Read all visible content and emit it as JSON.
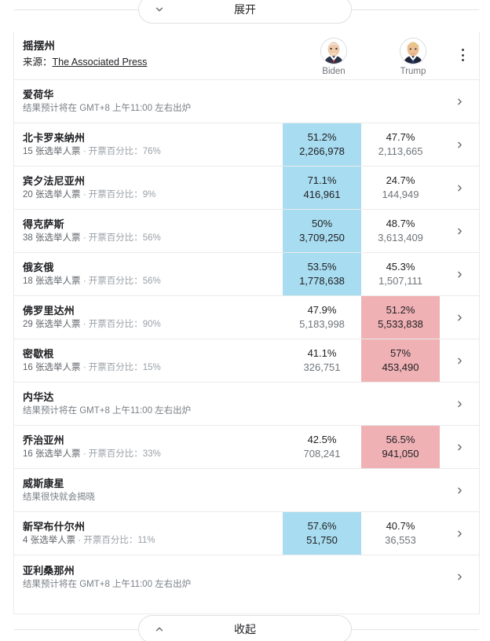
{
  "expand_button": {
    "label": "展开",
    "icon": "chevron-down-icon"
  },
  "collapse_button": {
    "label": "收起",
    "icon": "chevron-up-icon"
  },
  "header": {
    "title": "摇摆州",
    "source_prefix": "来源：",
    "source_name": "The Associated Press",
    "menu_icon": "overflow-menu-icon",
    "candidates": [
      {
        "name": "Biden",
        "avatar": "biden-avatar"
      },
      {
        "name": "Trump",
        "avatar": "trump-avatar"
      }
    ]
  },
  "colors": {
    "lead_blue": "#a8dcf0",
    "lead_red": "#f0b1b5",
    "text_primary": "#202124",
    "text_secondary": "#70757a",
    "border": "#eaeaea"
  },
  "chevron_icon": "chevron-right-icon",
  "rows": [
    {
      "state": "爱荷华",
      "note": "结果预计将在 GMT+8 上午11:00 左右出炉",
      "has_results": false
    },
    {
      "state": "北卡罗来纳州",
      "electoral": "15 张选举人票",
      "separator": " · ",
      "reporting": "开票百分比：76%",
      "has_results": true,
      "biden": {
        "pct": "51.2%",
        "votes": "2,266,978",
        "leading": true
      },
      "trump": {
        "pct": "47.7%",
        "votes": "2,113,665",
        "leading": false
      }
    },
    {
      "state": "宾夕法尼亚州",
      "electoral": "20 张选举人票",
      "separator": " · ",
      "reporting": "开票百分比：9%",
      "has_results": true,
      "biden": {
        "pct": "71.1%",
        "votes": "416,961",
        "leading": true
      },
      "trump": {
        "pct": "24.7%",
        "votes": "144,949",
        "leading": false
      }
    },
    {
      "state": "得克萨斯",
      "electoral": "38 张选举人票",
      "separator": " · ",
      "reporting": "开票百分比：56%",
      "has_results": true,
      "biden": {
        "pct": "50%",
        "votes": "3,709,250",
        "leading": true
      },
      "trump": {
        "pct": "48.7%",
        "votes": "3,613,409",
        "leading": false
      }
    },
    {
      "state": "俄亥俄",
      "electoral": "18 张选举人票",
      "separator": " · ",
      "reporting": "开票百分比：56%",
      "has_results": true,
      "biden": {
        "pct": "53.5%",
        "votes": "1,778,638",
        "leading": true
      },
      "trump": {
        "pct": "45.3%",
        "votes": "1,507,111",
        "leading": false
      }
    },
    {
      "state": "佛罗里达州",
      "electoral": "29 张选举人票",
      "separator": " · ",
      "reporting": "开票百分比：90%",
      "has_results": true,
      "biden": {
        "pct": "47.9%",
        "votes": "5,183,998",
        "leading": false
      },
      "trump": {
        "pct": "51.2%",
        "votes": "5,533,838",
        "leading": true
      }
    },
    {
      "state": "密歇根",
      "electoral": "16 张选举人票",
      "separator": " · ",
      "reporting": "开票百分比：15%",
      "has_results": true,
      "biden": {
        "pct": "41.1%",
        "votes": "326,751",
        "leading": false
      },
      "trump": {
        "pct": "57%",
        "votes": "453,490",
        "leading": true
      }
    },
    {
      "state": "内华达",
      "note": "结果预计将在 GMT+8 上午11:00 左右出炉",
      "has_results": false
    },
    {
      "state": "乔治亚州",
      "electoral": "16 张选举人票",
      "separator": " · ",
      "reporting": "开票百分比：33%",
      "has_results": true,
      "biden": {
        "pct": "42.5%",
        "votes": "708,241",
        "leading": false
      },
      "trump": {
        "pct": "56.5%",
        "votes": "941,050",
        "leading": true
      }
    },
    {
      "state": "威斯康星",
      "note": "结果很快就会揭晓",
      "has_results": false
    },
    {
      "state": "新罕布什尔州",
      "electoral": "4 张选举人票",
      "separator": " · ",
      "reporting": "开票百分比：11%",
      "has_results": true,
      "biden": {
        "pct": "57.6%",
        "votes": "51,750",
        "leading": true
      },
      "trump": {
        "pct": "40.7%",
        "votes": "36,553",
        "leading": false
      }
    },
    {
      "state": "亚利桑那州",
      "note": "结果预计将在 GMT+8 上午11:00 左右出炉",
      "has_results": false
    }
  ]
}
